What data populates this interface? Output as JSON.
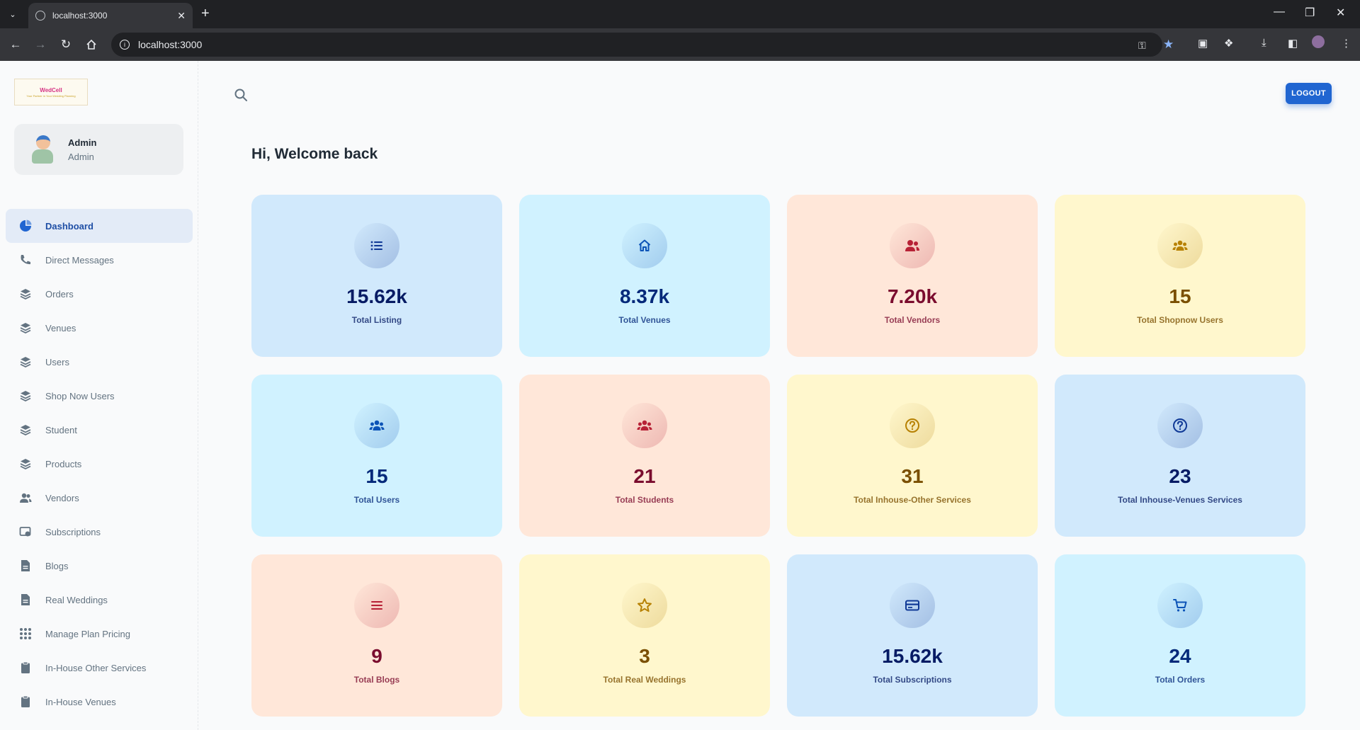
{
  "browser": {
    "tab_title": "localhost:3000",
    "url": "localhost:3000"
  },
  "sidebar": {
    "logo_text": "WedCell",
    "logo_tagline": "Your Partner in Your Wedding Planning",
    "user": {
      "name": "Admin",
      "role": "Admin"
    },
    "items": [
      {
        "label": "Dashboard",
        "icon": "pie-chart-icon",
        "active": true
      },
      {
        "label": "Direct Messages",
        "icon": "phone-icon"
      },
      {
        "label": "Orders",
        "icon": "layers-icon"
      },
      {
        "label": "Venues",
        "icon": "layers-icon"
      },
      {
        "label": "Users",
        "icon": "layers-icon"
      },
      {
        "label": "Shop Now Users",
        "icon": "layers-icon"
      },
      {
        "label": "Student",
        "icon": "layers-icon"
      },
      {
        "label": "Products",
        "icon": "layers-icon"
      },
      {
        "label": "Vendors",
        "icon": "people-icon"
      },
      {
        "label": "Subscriptions",
        "icon": "subscription-icon"
      },
      {
        "label": "Blogs",
        "icon": "document-icon"
      },
      {
        "label": "Real Weddings",
        "icon": "document-icon"
      },
      {
        "label": "Manage Plan Pricing",
        "icon": "grid-icon"
      },
      {
        "label": "In-House Other Services",
        "icon": "clipboard-icon"
      },
      {
        "label": "In-House Venues",
        "icon": "clipboard-icon"
      }
    ]
  },
  "header": {
    "logout_label": "LOGOUT"
  },
  "main": {
    "welcome": "Hi, Welcome back",
    "cards": [
      {
        "value": "15.62k",
        "label": "Total Listing",
        "icon": "list-icon",
        "color": "blue"
      },
      {
        "value": "8.37k",
        "label": "Total Venues",
        "icon": "home-icon",
        "color": "cyan"
      },
      {
        "value": "7.20k",
        "label": "Total Vendors",
        "icon": "users-icon",
        "color": "red"
      },
      {
        "value": "15",
        "label": "Total Shopnow Users",
        "icon": "group-icon",
        "color": "yellow"
      },
      {
        "value": "15",
        "label": "Total Users",
        "icon": "group-icon",
        "color": "cyan"
      },
      {
        "value": "21",
        "label": "Total Students",
        "icon": "group-icon",
        "color": "red"
      },
      {
        "value": "31",
        "label": "Total Inhouse-Other Services",
        "icon": "question-icon",
        "color": "yellow"
      },
      {
        "value": "23",
        "label": "Total Inhouse-Venues Services",
        "icon": "question-icon",
        "color": "blue"
      },
      {
        "value": "9",
        "label": "Total Blogs",
        "icon": "menu-icon",
        "color": "red"
      },
      {
        "value": "3",
        "label": "Total Real Weddings",
        "icon": "star-icon",
        "color": "yellow"
      },
      {
        "value": "15.62k",
        "label": "Total Subscriptions",
        "icon": "card-icon",
        "color": "blue"
      },
      {
        "value": "24",
        "label": "Total Orders",
        "icon": "cart-icon",
        "color": "cyan"
      }
    ]
  },
  "colors": {
    "primary": "#2065d1",
    "blue_bg": "#d1e9fc",
    "cyan_bg": "#d0f2ff",
    "red_bg": "#ffe7d9",
    "yellow_bg": "#fff7cd"
  }
}
